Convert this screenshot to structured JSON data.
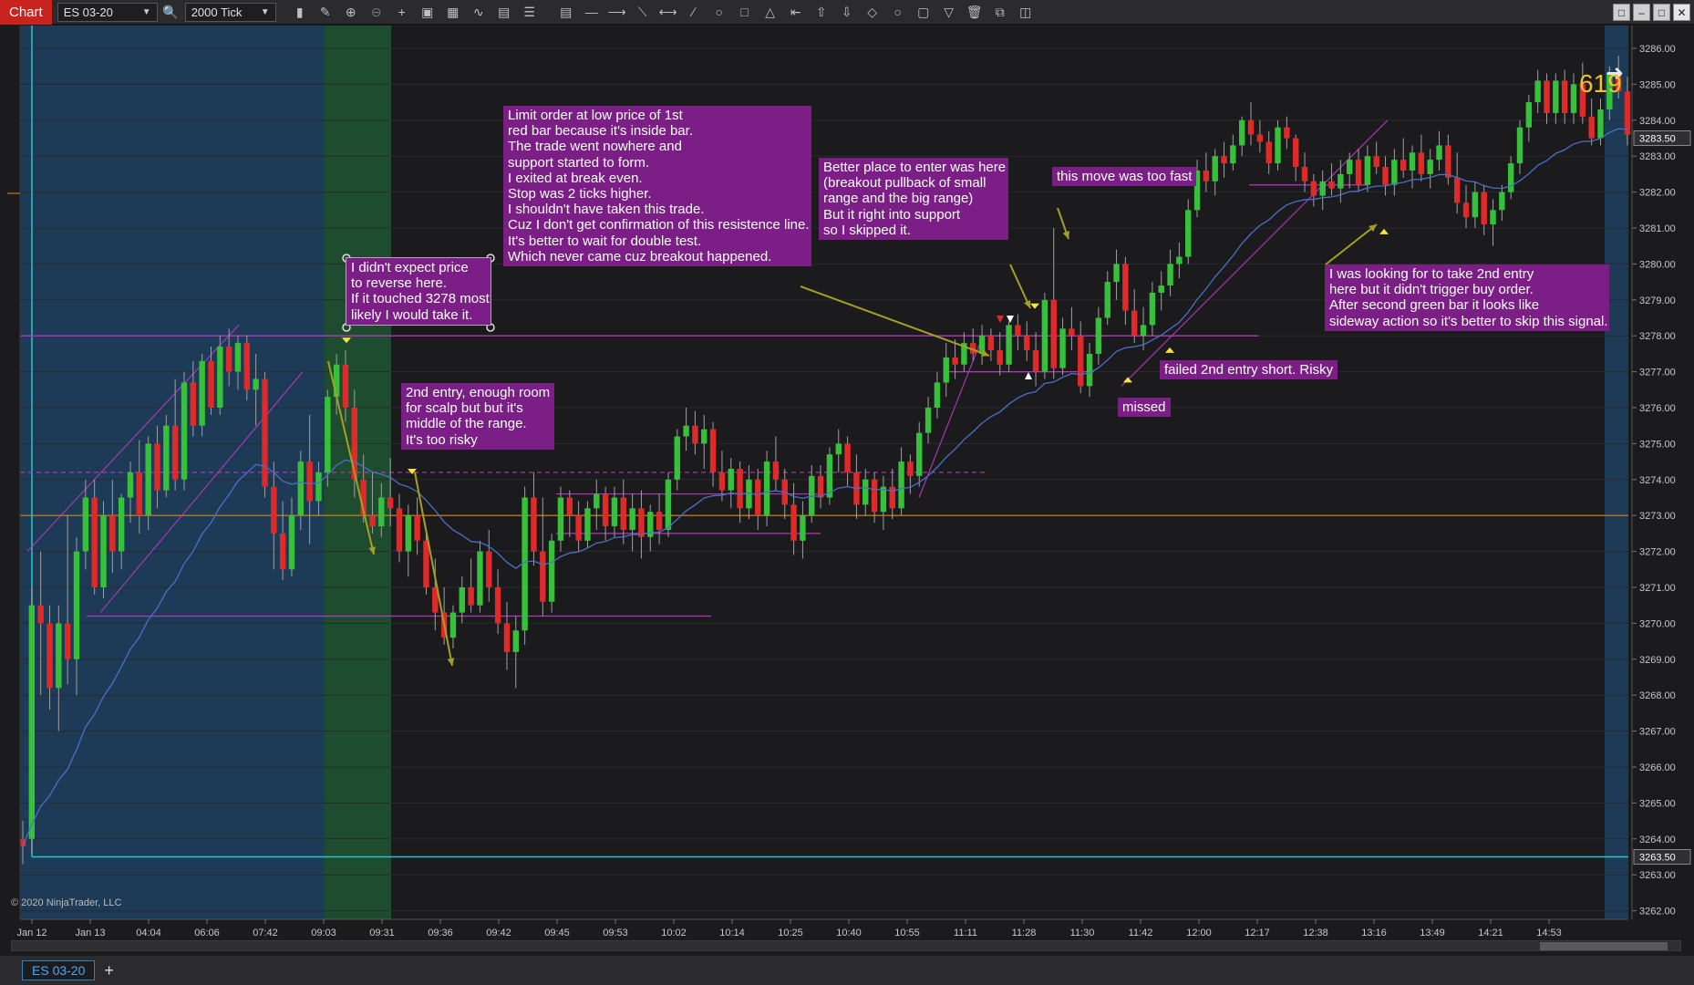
{
  "toolbar": {
    "chart_label": "Chart",
    "instrument": "ES 03-20",
    "interval": "2000 Tick",
    "icons": [
      "search-icon",
      "bar-type-icon",
      "pencil-icon",
      "zoom-in-icon",
      "zoom-out-icon",
      "crosshair-icon",
      "template-icon",
      "properties-icon",
      "indicator-icon",
      "strategy-icon",
      "list-icon",
      "ruler-icon",
      "line-icon",
      "ray-icon",
      "extended-line-icon",
      "arrow-line-icon",
      "fib-icon",
      "ellipse-icon",
      "rectangle-icon",
      "triangle-icon",
      "arrow-left-icon",
      "arrow-up-icon",
      "arrow-down-icon",
      "diamond-icon",
      "circle-icon",
      "square-icon",
      "triangle-down-icon",
      "delete-icon",
      "copy-icon",
      "layers-icon"
    ]
  },
  "price_axis": {
    "labels": [
      "3286.00",
      "3285.00",
      "3284.00",
      "3283.00",
      "3282.00",
      "3281.00",
      "3280.00",
      "3279.00",
      "3278.00",
      "3277.00",
      "3276.00",
      "3275.00",
      "3274.00",
      "3273.00",
      "3272.00",
      "3271.00",
      "3270.00",
      "3269.00",
      "3268.00",
      "3267.00",
      "3266.00",
      "3265.00",
      "3264.00",
      "3263.00",
      "3262.00"
    ],
    "current_price": "3283.50",
    "low_marker": "3263.50"
  },
  "time_axis": {
    "labels": [
      "Jan 12",
      "Jan 13",
      "04:04",
      "06:06",
      "07:42",
      "09:03",
      "09:31",
      "09:36",
      "09:42",
      "09:45",
      "09:53",
      "10:02",
      "10:14",
      "10:25",
      "10:40",
      "10:55",
      "11:11",
      "11:28",
      "11:30",
      "11:42",
      "12:00",
      "12:17",
      "12:38",
      "13:16",
      "13:49",
      "14:21",
      "14:53"
    ]
  },
  "annotations": {
    "note1": "I didn't expect price\nto reverse here.\nIf it touched 3278 most\nlikely I would take it.",
    "note2": "Limit order at low price of 1st\nred bar because it's inside bar.\nThe trade went nowhere and\nsupport started to form.\nI exited at break even.\nStop was 2 ticks higher.\nI shouldn't have taken this trade.\nCuz I don't get confirmation of this resistence line.\nIt's better to wait for double test.\nWhich never came cuz breakout happened.",
    "note3": "2nd entry, enough room\nfor scalp but but it's\nmiddle of the range.\nIt's too risky",
    "note4": "Better place to enter was here\n(breakout pullback of small\nrange and the big range)\nBut it right into support\nso I skipped it.",
    "note5": "this move was too fast",
    "note6": "failed 2nd entry short. Risky",
    "note7": "missed",
    "note8": "I was looking for to take 2nd entry\nhere but it didn't trigger buy order.\nAfter second green bar it looks like\nsideway action so it's better to skip this signal."
  },
  "indicator_value": "619",
  "copyright": "© 2020 NinjaTrader, LLC",
  "tabs": {
    "active": "ES 03-20",
    "add": "+"
  },
  "colors": {
    "bull": "#35c23a",
    "bear": "#e02a2a",
    "annotation_bg": "#7b1f86",
    "session_blue": "#1d3a56",
    "session_green": "#1d4d2e",
    "ema": "#4a70c8",
    "orange_level": "#d98a1a",
    "cyan_level": "#2bc4cf",
    "magenta_line": "#b23ab8",
    "arrow_olive": "#a6a022"
  },
  "chart_data": {
    "type": "candlestick",
    "ylim": [
      3262,
      3286.5
    ],
    "candles": [
      [
        3264,
        3264.5,
        3263.3,
        3263.8
      ],
      [
        3264,
        3271,
        3263.6,
        3270.5
      ],
      [
        3270.5,
        3272,
        3268,
        3270
      ],
      [
        3270,
        3270.5,
        3267.6,
        3268.2
      ],
      [
        3268.2,
        3270.5,
        3267,
        3270
      ],
      [
        3270,
        3273,
        3268.3,
        3269
      ],
      [
        3269,
        3272.4,
        3268,
        3272
      ],
      [
        3272,
        3274,
        3271.5,
        3273.5
      ],
      [
        3273.5,
        3274,
        3270.8,
        3271
      ],
      [
        3271,
        3273.4,
        3270.7,
        3273
      ],
      [
        3273,
        3274,
        3271.4,
        3272
      ],
      [
        3272,
        3273.6,
        3271.5,
        3273.5
      ],
      [
        3273.5,
        3274.5,
        3272.8,
        3274.2
      ],
      [
        3274.2,
        3275.1,
        3272.5,
        3273
      ],
      [
        3273,
        3275.2,
        3272.6,
        3275
      ],
      [
        3275,
        3275.5,
        3273.2,
        3273.7
      ],
      [
        3273.7,
        3275.8,
        3273.5,
        3275.5
      ],
      [
        3275.5,
        3276.8,
        3273.7,
        3274
      ],
      [
        3274,
        3277,
        3273.7,
        3276.7
      ],
      [
        3276.7,
        3277.3,
        3275.2,
        3275.5
      ],
      [
        3275.5,
        3277.5,
        3275.2,
        3277.3
      ],
      [
        3277.3,
        3277.7,
        3275.8,
        3276
      ],
      [
        3276,
        3278,
        3275.8,
        3277.7
      ],
      [
        3277.7,
        3278.2,
        3276.6,
        3277
      ],
      [
        3277,
        3278,
        3276.5,
        3277.8
      ],
      [
        3277.8,
        3278,
        3276.2,
        3276.5
      ],
      [
        3276.5,
        3277.5,
        3275.5,
        3276.8
      ],
      [
        3276.8,
        3277,
        3273.5,
        3273.8
      ],
      [
        3273.8,
        3274.5,
        3271.5,
        3272.5
      ],
      [
        3272.5,
        3273.4,
        3271.2,
        3271.5
      ],
      [
        3271.5,
        3273.5,
        3271.3,
        3273
      ],
      [
        3273,
        3274.8,
        3272.6,
        3274.5
      ],
      [
        3274.5,
        3275.8,
        3272.2,
        3273.4
      ],
      [
        3273.4,
        3274.5,
        3273,
        3274.2
      ],
      [
        3274.2,
        3276.5,
        3273.8,
        3276.3
      ],
      [
        3276.3,
        3277.5,
        3275.8,
        3277.2
      ],
      [
        3277.2,
        3277.6,
        3275.6,
        3276
      ],
      [
        3276,
        3276.5,
        3273.5,
        3274
      ],
      [
        3274,
        3274.7,
        3272.8,
        3273
      ],
      [
        3273,
        3274.2,
        3272.5,
        3272.7
      ],
      [
        3272.7,
        3273.9,
        3272.4,
        3273.5
      ],
      [
        3273.5,
        3274.6,
        3272.7,
        3273.2
      ],
      [
        3273.2,
        3273.6,
        3271.7,
        3272
      ],
      [
        3272,
        3273.3,
        3271.3,
        3273
      ],
      [
        3273,
        3273.5,
        3271.9,
        3272.3
      ],
      [
        3272.3,
        3272.6,
        3270.8,
        3271
      ],
      [
        3271,
        3271.8,
        3269.8,
        3270.3
      ],
      [
        3270.3,
        3271,
        3269.4,
        3269.6
      ],
      [
        3269.6,
        3270.5,
        3269.3,
        3270.3
      ],
      [
        3270.3,
        3271.3,
        3270,
        3271
      ],
      [
        3271,
        3271.8,
        3270.3,
        3270.5
      ],
      [
        3270.5,
        3272.3,
        3270.3,
        3272
      ],
      [
        3272,
        3272.6,
        3270.6,
        3271
      ],
      [
        3271,
        3271.5,
        3269.7,
        3270
      ],
      [
        3270,
        3270.6,
        3268.7,
        3269.2
      ],
      [
        3269.2,
        3270.2,
        3268.2,
        3269.8
      ],
      [
        3269.8,
        3273.8,
        3269.4,
        3273.5
      ],
      [
        3273.5,
        3274.2,
        3271.6,
        3272
      ],
      [
        3272,
        3273.5,
        3270.2,
        3270.6
      ],
      [
        3270.6,
        3272.5,
        3270.3,
        3272.3
      ],
      [
        3272.3,
        3273.8,
        3272,
        3273.5
      ],
      [
        3273.5,
        3273.7,
        3272.4,
        3273
      ],
      [
        3273,
        3273.4,
        3272,
        3272.3
      ],
      [
        3272.3,
        3273.4,
        3272.1,
        3273.2
      ],
      [
        3273.2,
        3274,
        3272.6,
        3273.6
      ],
      [
        3273.6,
        3273.8,
        3272.3,
        3272.7
      ],
      [
        3272.7,
        3273.8,
        3272.4,
        3273.5
      ],
      [
        3273.5,
        3274,
        3272.2,
        3272.6
      ],
      [
        3272.6,
        3273.6,
        3272,
        3273.2
      ],
      [
        3273.2,
        3273.7,
        3271.8,
        3272.4
      ],
      [
        3272.4,
        3273.3,
        3272,
        3273.1
      ],
      [
        3273.1,
        3273.6,
        3272.2,
        3272.6
      ],
      [
        3272.6,
        3274.2,
        3272.4,
        3274
      ],
      [
        3274,
        3275.4,
        3273.7,
        3275.2
      ],
      [
        3275.2,
        3276,
        3274.8,
        3275.5
      ],
      [
        3275.5,
        3275.9,
        3274.7,
        3275
      ],
      [
        3275,
        3275.8,
        3274.3,
        3275.4
      ],
      [
        3275.4,
        3275.6,
        3273.8,
        3274.2
      ],
      [
        3274.2,
        3274.8,
        3273.4,
        3273.7
      ],
      [
        3273.7,
        3274.6,
        3273.2,
        3274.3
      ],
      [
        3274.3,
        3274.5,
        3272.8,
        3273.2
      ],
      [
        3273.2,
        3274.4,
        3272.9,
        3274
      ],
      [
        3274,
        3274.3,
        3272.6,
        3273
      ],
      [
        3273,
        3274.8,
        3272.7,
        3274.5
      ],
      [
        3274.5,
        3275.2,
        3273.7,
        3274
      ],
      [
        3274,
        3274.3,
        3272.9,
        3273.3
      ],
      [
        3273.3,
        3273.9,
        3271.9,
        3272.3
      ],
      [
        3272.3,
        3273.4,
        3271.8,
        3273
      ],
      [
        3273,
        3274.4,
        3272.8,
        3274.1
      ],
      [
        3274.1,
        3274.4,
        3273.2,
        3273.5
      ],
      [
        3273.5,
        3274.9,
        3273.3,
        3274.7
      ],
      [
        3274.7,
        3275.4,
        3274.2,
        3275
      ],
      [
        3275,
        3275.2,
        3273.8,
        3274.2
      ],
      [
        3274.2,
        3274.7,
        3272.9,
        3273.3
      ],
      [
        3273.3,
        3274.3,
        3273,
        3274
      ],
      [
        3274,
        3274.2,
        3272.8,
        3273.1
      ],
      [
        3273.1,
        3274.1,
        3272.6,
        3273.8
      ],
      [
        3273.8,
        3274.3,
        3272.9,
        3273.2
      ],
      [
        3273.2,
        3274.9,
        3273,
        3274.5
      ],
      [
        3274.5,
        3274.7,
        3273.6,
        3274.1
      ],
      [
        3274.1,
        3275.6,
        3273.8,
        3275.3
      ],
      [
        3275.3,
        3276.3,
        3275,
        3276
      ],
      [
        3276,
        3277,
        3275.7,
        3276.7
      ],
      [
        3276.7,
        3277.8,
        3276.3,
        3277.4
      ],
      [
        3277.4,
        3277.9,
        3276.8,
        3277.2
      ],
      [
        3277.2,
        3278.1,
        3277,
        3277.8
      ],
      [
        3277.8,
        3278.2,
        3277.3,
        3277.5
      ],
      [
        3277.5,
        3278.3,
        3277.2,
        3278
      ],
      [
        3278,
        3278.2,
        3277.3,
        3277.6
      ],
      [
        3277.6,
        3278.1,
        3276.9,
        3277.2
      ],
      [
        3277.2,
        3278.4,
        3277,
        3278.3
      ],
      [
        3278.3,
        3278.6,
        3277.6,
        3278
      ],
      [
        3278,
        3278.4,
        3277.3,
        3277.6
      ],
      [
        3277.6,
        3278.1,
        3276.6,
        3277
      ],
      [
        3277,
        3279.2,
        3276.8,
        3279
      ],
      [
        3279,
        3281,
        3276.8,
        3277.1
      ],
      [
        3277.1,
        3278.5,
        3276.9,
        3278.2
      ],
      [
        3278.2,
        3278.8,
        3277.6,
        3278
      ],
      [
        3278,
        3278.4,
        3276.4,
        3276.6
      ],
      [
        3276.6,
        3277.8,
        3276.3,
        3277.5
      ],
      [
        3277.5,
        3278.8,
        3277.2,
        3278.5
      ],
      [
        3278.5,
        3279.8,
        3278.3,
        3279.5
      ],
      [
        3279.5,
        3280.4,
        3279,
        3280
      ],
      [
        3280,
        3280.2,
        3278.3,
        3278.7
      ],
      [
        3278.7,
        3279.3,
        3277.8,
        3278
      ],
      [
        3278,
        3278.8,
        3277.6,
        3278.3
      ],
      [
        3278.3,
        3279.5,
        3278,
        3279.2
      ],
      [
        3279.2,
        3279.8,
        3278.7,
        3279.4
      ],
      [
        3279.4,
        3280.4,
        3279.1,
        3280
      ],
      [
        3280,
        3280.6,
        3279.6,
        3280.2
      ],
      [
        3280.2,
        3281.8,
        3280,
        3281.5
      ],
      [
        3281.5,
        3282.9,
        3281.3,
        3282.6
      ],
      [
        3282.6,
        3283.1,
        3282,
        3282.3
      ],
      [
        3282.3,
        3283.2,
        3281.9,
        3283
      ],
      [
        3283,
        3283.4,
        3282.4,
        3282.8
      ],
      [
        3282.8,
        3283.6,
        3282.6,
        3283.3
      ],
      [
        3283.3,
        3284.1,
        3283,
        3284
      ],
      [
        3284,
        3284.5,
        3283.3,
        3283.6
      ],
      [
        3283.6,
        3284,
        3283.1,
        3283.4
      ],
      [
        3283.4,
        3283.7,
        3282.5,
        3282.8
      ],
      [
        3282.8,
        3284,
        3282.6,
        3283.8
      ],
      [
        3283.8,
        3284.1,
        3283.2,
        3283.5
      ],
      [
        3283.5,
        3283.6,
        3282.3,
        3282.7
      ],
      [
        3282.7,
        3283.1,
        3282,
        3282.3
      ],
      [
        3282.3,
        3282.5,
        3281.6,
        3281.9
      ],
      [
        3281.9,
        3282.6,
        3281.5,
        3282.3
      ],
      [
        3282.3,
        3282.8,
        3281.9,
        3282.1
      ],
      [
        3282.1,
        3282.9,
        3281.7,
        3282.5
      ],
      [
        3282.5,
        3283.1,
        3282.1,
        3282.9
      ],
      [
        3282.9,
        3283.2,
        3282,
        3282.2
      ],
      [
        3282.2,
        3283.3,
        3282,
        3283
      ],
      [
        3283,
        3283.4,
        3282.5,
        3282.7
      ],
      [
        3282.7,
        3283,
        3281.9,
        3282.2
      ],
      [
        3282.2,
        3283.2,
        3281.9,
        3282.9
      ],
      [
        3282.9,
        3283.5,
        3282.4,
        3282.6
      ],
      [
        3282.6,
        3283.3,
        3282.1,
        3283.1
      ],
      [
        3283.1,
        3283.6,
        3282.3,
        3282.5
      ],
      [
        3282.5,
        3283.2,
        3282.1,
        3282.9
      ],
      [
        3282.9,
        3283.7,
        3282.6,
        3283.3
      ],
      [
        3283.3,
        3283.6,
        3282.2,
        3282.4
      ],
      [
        3282.4,
        3283.1,
        3281.4,
        3281.7
      ],
      [
        3281.7,
        3282.2,
        3281,
        3281.3
      ],
      [
        3281.3,
        3282.3,
        3281,
        3282
      ],
      [
        3282,
        3282.2,
        3280.8,
        3281.1
      ],
      [
        3281.1,
        3281.8,
        3280.5,
        3281.5
      ],
      [
        3281.5,
        3282.2,
        3281.2,
        3282
      ],
      [
        3282,
        3283,
        3281.8,
        3282.8
      ],
      [
        3282.8,
        3284,
        3282.5,
        3283.8
      ],
      [
        3283.8,
        3284.7,
        3283.4,
        3284.5
      ],
      [
        3284.5,
        3285.4,
        3284.2,
        3285.1
      ],
      [
        3285.1,
        3285.3,
        3283.9,
        3284.2
      ],
      [
        3284.2,
        3285.3,
        3283.9,
        3285.1
      ],
      [
        3285.1,
        3285.4,
        3283.9,
        3284.2
      ],
      [
        3284.2,
        3285.3,
        3283.9,
        3285
      ],
      [
        3285,
        3285.6,
        3283.9,
        3284.1
      ],
      [
        3284.1,
        3284.6,
        3283.3,
        3283.5
      ],
      [
        3283.5,
        3284.6,
        3283.3,
        3284.3
      ],
      [
        3284.3,
        3285.5,
        3284,
        3285.3
      ],
      [
        3285.3,
        3285.8,
        3284.6,
        3284.8
      ],
      [
        3284.8,
        3285.2,
        3283.3,
        3283.6
      ]
    ]
  }
}
